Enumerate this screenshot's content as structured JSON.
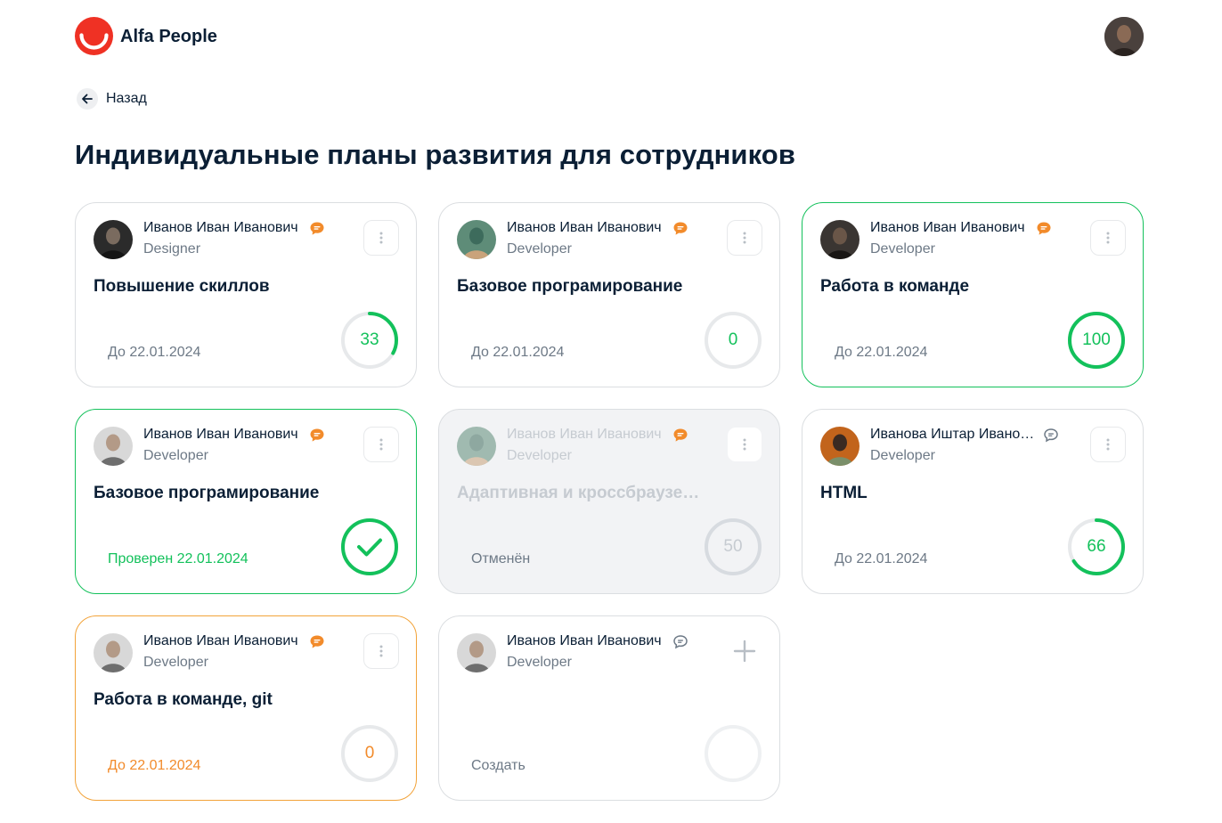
{
  "app": {
    "brand": "Alfa People"
  },
  "nav": {
    "back_label": "Назад"
  },
  "page": {
    "title": "Индивидуальные планы развития для сотрудников"
  },
  "colors": {
    "accent_red": "#ef3124",
    "green": "#13c15b",
    "orange": "#f28b2b",
    "muted": "#6d7986",
    "ring_track": "#e7e9eb"
  },
  "cards": [
    {
      "name": "Иванов Иван Иванович",
      "role": "Designer",
      "goal": "Повышение скиллов",
      "status_text": "До 22.01.2024",
      "progress": 33,
      "progress_label": "33",
      "chat_icon": "chat-orange-icon",
      "state": "in-progress"
    },
    {
      "name": "Иванов Иван Иванович",
      "role": "Developer",
      "goal": "Базовое програмирование",
      "status_text": "До 22.01.2024",
      "progress": 0,
      "progress_label": "0",
      "chat_icon": "chat-orange-icon",
      "state": "in-progress"
    },
    {
      "name": "Иванов Иван Иванович",
      "role": "Developer",
      "goal": "Работа в команде",
      "status_text": "До 22.01.2024",
      "progress": 100,
      "progress_label": "100",
      "chat_icon": "chat-orange-icon",
      "state": "completed"
    },
    {
      "name": "Иванов Иван Иванович",
      "role": "Developer",
      "goal": "Базовое програмирование",
      "status_text": "Проверен 22.01.2024",
      "progress": 100,
      "progress_label": "",
      "chat_icon": "chat-orange-icon",
      "state": "verified"
    },
    {
      "name": "Иванов Иван Иванович",
      "role": "Developer",
      "goal": "Адаптивная и кроссбраузерная верстка",
      "status_text": "Отменён",
      "progress": 50,
      "progress_label": "50",
      "chat_icon": "chat-orange-icon",
      "state": "cancelled"
    },
    {
      "name": "Иванова Иштар Ивановна",
      "role": "Developer",
      "goal": "HTML",
      "status_text": "До 22.01.2024",
      "progress": 66,
      "progress_label": "66",
      "chat_icon": "chat-outline-icon",
      "state": "in-progress"
    },
    {
      "name": "Иванов Иван Иванович",
      "role": "Developer",
      "goal": "Работа в команде, git",
      "status_text": "До 22.01.2024",
      "progress": 0,
      "progress_label": "0",
      "chat_icon": "chat-orange-icon",
      "state": "overdue"
    },
    {
      "name": "Иванов Иван Иванович",
      "role": "Developer",
      "goal": "",
      "status_text": "Создать",
      "progress": 0,
      "progress_label": "",
      "chat_icon": "chat-outline-icon",
      "state": "empty"
    }
  ]
}
